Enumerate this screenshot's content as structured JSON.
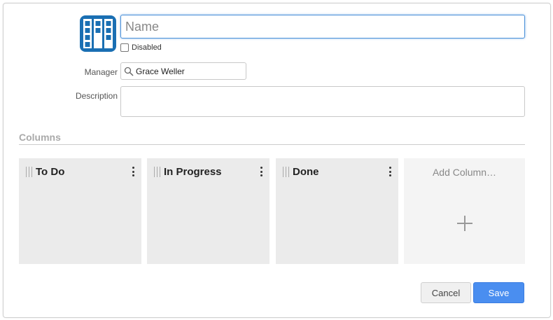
{
  "form": {
    "name_placeholder": "Name",
    "name_value": "",
    "disabled_label": "Disabled",
    "disabled_checked": false,
    "manager_label": "Manager",
    "manager_value": "Grace Weller",
    "description_label": "Description",
    "description_value": ""
  },
  "columns_section": {
    "title": "Columns",
    "columns": [
      {
        "title": "To Do"
      },
      {
        "title": "In Progress"
      },
      {
        "title": "Done"
      }
    ],
    "add_column_label": "Add Column…"
  },
  "buttons": {
    "cancel": "Cancel",
    "save": "Save"
  },
  "colors": {
    "icon_blue": "#1a6fb3",
    "save_blue": "#4a8ef0",
    "focus_blue": "#4a90d9"
  },
  "icons": {
    "board": "kanban-board-icon",
    "manager": "search-icon",
    "column_grip": "drag-handle-icon",
    "column_menu": "vertical-ellipsis-icon",
    "add": "plus-icon"
  }
}
